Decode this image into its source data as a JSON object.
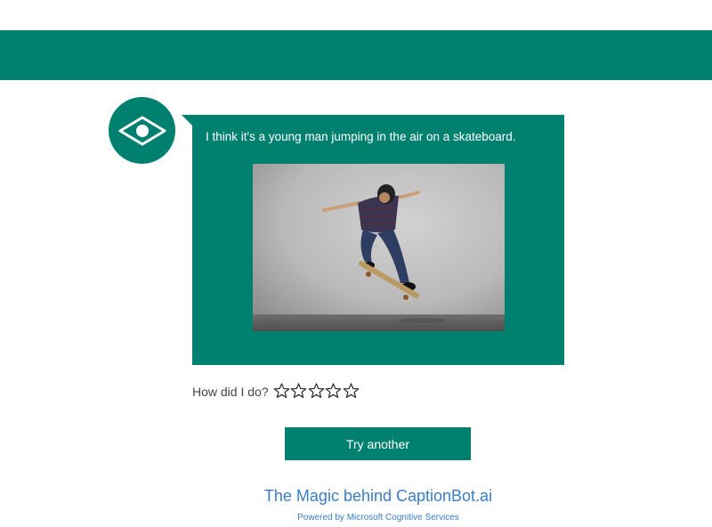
{
  "bot": {
    "caption": "I think it's a young man jumping in the air on a skateboard."
  },
  "photo": {
    "alt": "young man jumping in the air on a skateboard"
  },
  "rating": {
    "label": "How did I do?",
    "stars_total": 5,
    "stars_filled": 0
  },
  "actions": {
    "try_another_label": "Try another"
  },
  "footer": {
    "magic_link": "The Magic behind CaptionBot.ai",
    "powered_by": "Powered by Microsoft Cognitive Services"
  },
  "colors": {
    "brand_green": "#00806f",
    "link_blue": "#3a7cc9"
  },
  "icons": {
    "avatar": "eye-icon",
    "rating": "star-outline-icon"
  }
}
